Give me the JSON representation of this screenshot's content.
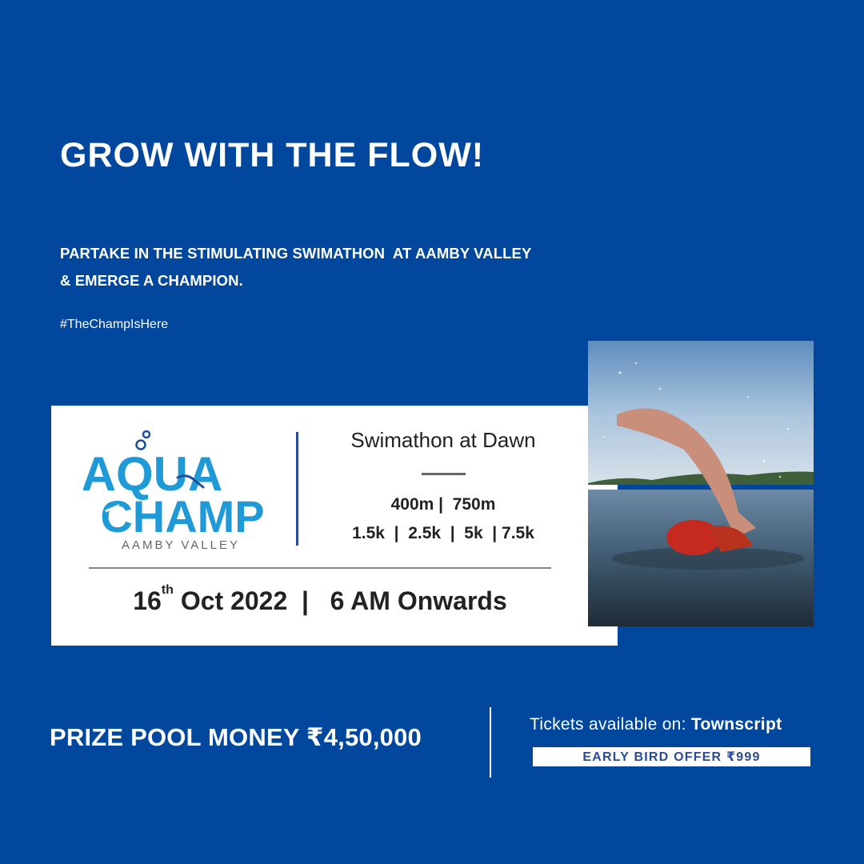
{
  "headline": "GROW WITH THE FLOW!",
  "subline_1": "PARTAKE IN THE STIMULATING SWIMATHON  AT AAMBY VALLEY",
  "subline_2": "& EMERGE A CHAMPION.",
  "hashtag": "#TheChampIsHere",
  "logo": {
    "word1": "AQUA",
    "word2": "CHAMP",
    "tagline": "AAMBY VALLEY",
    "color_main": "#1f9ad6",
    "color_dark": "#1c4f9a"
  },
  "event": {
    "title": "Swimathon at Dawn",
    "distances_row1": "400m |  750m",
    "distances_row2": "1.5k  |  2.5k  |  5k  | 7.5k",
    "date_day": "16",
    "date_suffix": "th",
    "date_rest": " Oct 2022  |   6 AM Onwards"
  },
  "prize": "PRIZE POOL MONEY ₹4,50,000",
  "tickets": {
    "prefix": "Tickets available on: ",
    "platform": "Townscript"
  },
  "offer": "EARLY BIRD OFFER ₹999",
  "colors": {
    "background": "#00479d",
    "card": "#ffffff",
    "accent": "#2a4b9a"
  }
}
